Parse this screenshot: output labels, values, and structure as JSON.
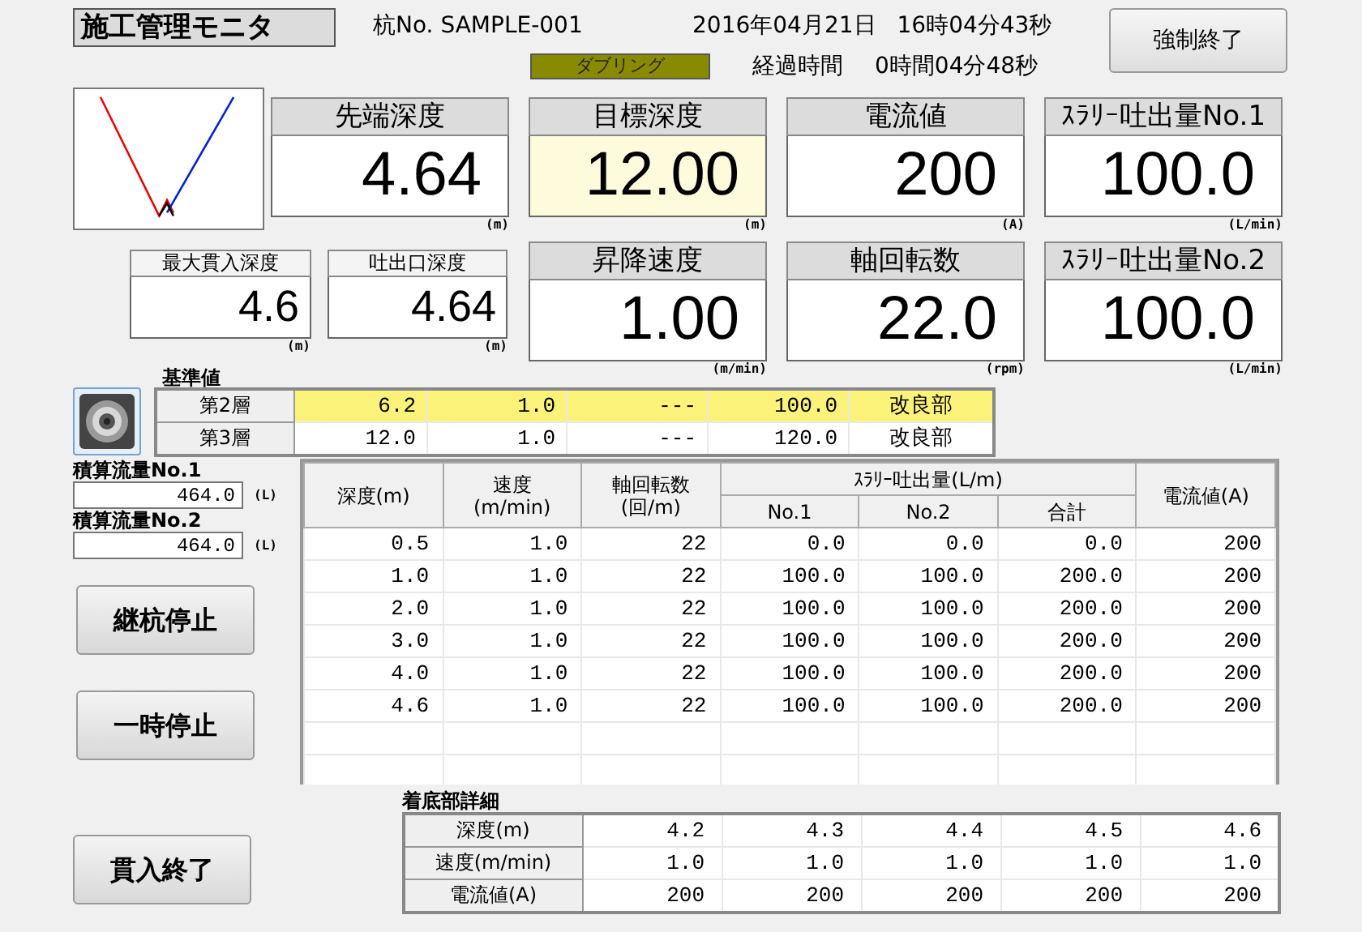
{
  "title": "施工管理モニタ",
  "pile_no": "杭No. SAMPLE-001",
  "date": "2016年04月21日",
  "time": "16時04分43秒",
  "force_stop_button": "強制終了",
  "doubling_badge": "ダブリング",
  "elapsed_label": "経過時間",
  "elapsed": "0時間04分48秒",
  "metrics_top": [
    {
      "label": "先端深度",
      "value": "4.64",
      "unit": "(m)",
      "highlighted": false
    },
    {
      "label": "目標深度",
      "value": "12.00",
      "unit": "(m)",
      "highlighted": true
    },
    {
      "label": "電流値",
      "value": "200",
      "unit": "(A)",
      "highlighted": false
    },
    {
      "label": "ｽﾗﾘｰ吐出量No.1",
      "value": "100.0",
      "unit": "(L/min)",
      "highlighted": false
    }
  ],
  "depth_boxes": [
    {
      "label": "最大貫入深度",
      "value": "4.6",
      "unit": "(m)"
    },
    {
      "label": "吐出口深度",
      "value": "4.64",
      "unit": "(m)"
    }
  ],
  "metrics_bottom": [
    {
      "label": "昇降速度",
      "value": "1.00",
      "unit": "(m/min)",
      "highlighted": false
    },
    {
      "label": "軸回転数",
      "value": "22.0",
      "unit": "(rpm)",
      "highlighted": false
    },
    {
      "label": "ｽﾗﾘｰ吐出量No.2",
      "value": "100.0",
      "unit": "(L/min)",
      "highlighted": false
    }
  ],
  "reference": {
    "label": "基準値",
    "rows": [
      {
        "cells": [
          "第2層",
          "6.2",
          "1.0",
          "---",
          "100.0",
          "改良部"
        ],
        "selected": true
      },
      {
        "cells": [
          "第3層",
          "12.0",
          "1.0",
          "---",
          "120.0",
          "改良部"
        ],
        "selected": false
      }
    ]
  },
  "totals": [
    {
      "label": "積算流量No.1",
      "value": "464.0",
      "unit": "(L)"
    },
    {
      "label": "積算流量No.2",
      "value": "464.0",
      "unit": "(L)"
    }
  ],
  "buttons": [
    "継杭停止",
    "一時停止"
  ],
  "finish_button": "貫入終了",
  "table": {
    "column_group": "ｽﾗﾘｰ吐出量(L/m)",
    "columns": [
      {
        "lines": [
          "深度(m)"
        ],
        "in_group": false
      },
      {
        "lines": [
          "速度",
          "(m/min)"
        ],
        "in_group": false
      },
      {
        "lines": [
          "軸回転数",
          "(回/m)"
        ],
        "in_group": false
      },
      {
        "lines": [
          "No.1"
        ],
        "in_group": true
      },
      {
        "lines": [
          "No.2"
        ],
        "in_group": true
      },
      {
        "lines": [
          "合計"
        ],
        "in_group": true
      },
      {
        "lines": [
          "電流値(A)"
        ],
        "in_group": false
      }
    ],
    "rows": [
      [
        "0.5",
        "1.0",
        "22",
        "0.0",
        "0.0",
        "0.0",
        "200"
      ],
      [
        "1.0",
        "1.0",
        "22",
        "100.0",
        "100.0",
        "200.0",
        "200"
      ],
      [
        "2.0",
        "1.0",
        "22",
        "100.0",
        "100.0",
        "200.0",
        "200"
      ],
      [
        "3.0",
        "1.0",
        "22",
        "100.0",
        "100.0",
        "200.0",
        "200"
      ],
      [
        "4.0",
        "1.0",
        "22",
        "100.0",
        "100.0",
        "200.0",
        "200"
      ],
      [
        "4.6",
        "1.0",
        "22",
        "100.0",
        "100.0",
        "200.0",
        "200"
      ]
    ]
  },
  "bottom_detail": {
    "label": "着底部詳細",
    "rows": [
      {
        "label": "深度(m)",
        "values": [
          "4.2",
          "4.3",
          "4.4",
          "4.5",
          "4.6"
        ]
      },
      {
        "label": "速度(m/min)",
        "values": [
          "1.0",
          "1.0",
          "1.0",
          "1.0",
          "1.0"
        ]
      },
      {
        "label": "電流値(A)",
        "values": [
          "200",
          "200",
          "200",
          "200",
          "200"
        ]
      }
    ]
  }
}
